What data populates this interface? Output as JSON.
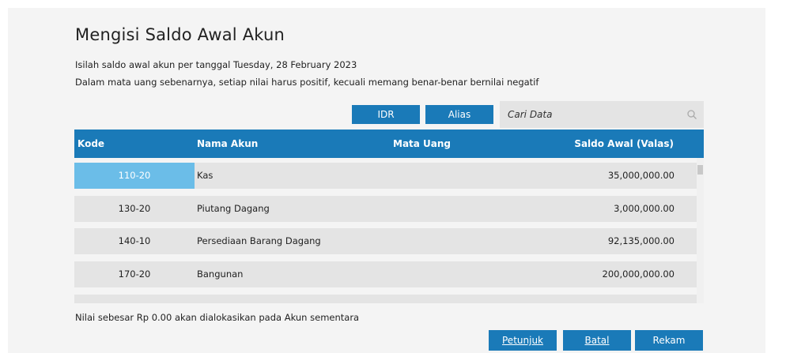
{
  "header": {
    "title": "Mengisi Saldo Awal Akun",
    "desc_line1": "Isilah saldo awal akun per tanggal Tuesday, 28 February 2023",
    "desc_line2": "Dalam mata uang sebenarnya, setiap nilai harus positif, kecuali memang benar-benar bernilai negatif"
  },
  "toolbar": {
    "idr_label": "IDR",
    "alias_label": "Alias",
    "search_placeholder": "Cari Data"
  },
  "table": {
    "columns": [
      "Kode",
      "Nama Akun",
      "Mata Uang",
      "Saldo Awal (Valas)"
    ],
    "rows": [
      {
        "kode": "110-20",
        "nama": "Kas",
        "mata_uang": "",
        "saldo": "35,000,000.00",
        "selected": true
      },
      {
        "kode": "130-20",
        "nama": "Piutang Dagang",
        "mata_uang": "",
        "saldo": "3,000,000.00",
        "selected": false
      },
      {
        "kode": "140-10",
        "nama": "Persediaan Barang Dagang",
        "mata_uang": "",
        "saldo": "92,135,000.00",
        "selected": false
      },
      {
        "kode": "170-20",
        "nama": "Bangunan",
        "mata_uang": "",
        "saldo": "200,000,000.00",
        "selected": false
      }
    ]
  },
  "footer": {
    "note": "Nilai sebesar Rp 0.00 akan dialokasikan pada Akun sementara",
    "petunjuk_label": "Petunjuk",
    "batal_label": "Batal",
    "rekam_label": "Rekam"
  },
  "colors": {
    "accent": "#1a7ab8",
    "selected": "#6bbde8",
    "row_bg": "#e4e4e4"
  },
  "icons": {
    "search": "search-icon"
  }
}
